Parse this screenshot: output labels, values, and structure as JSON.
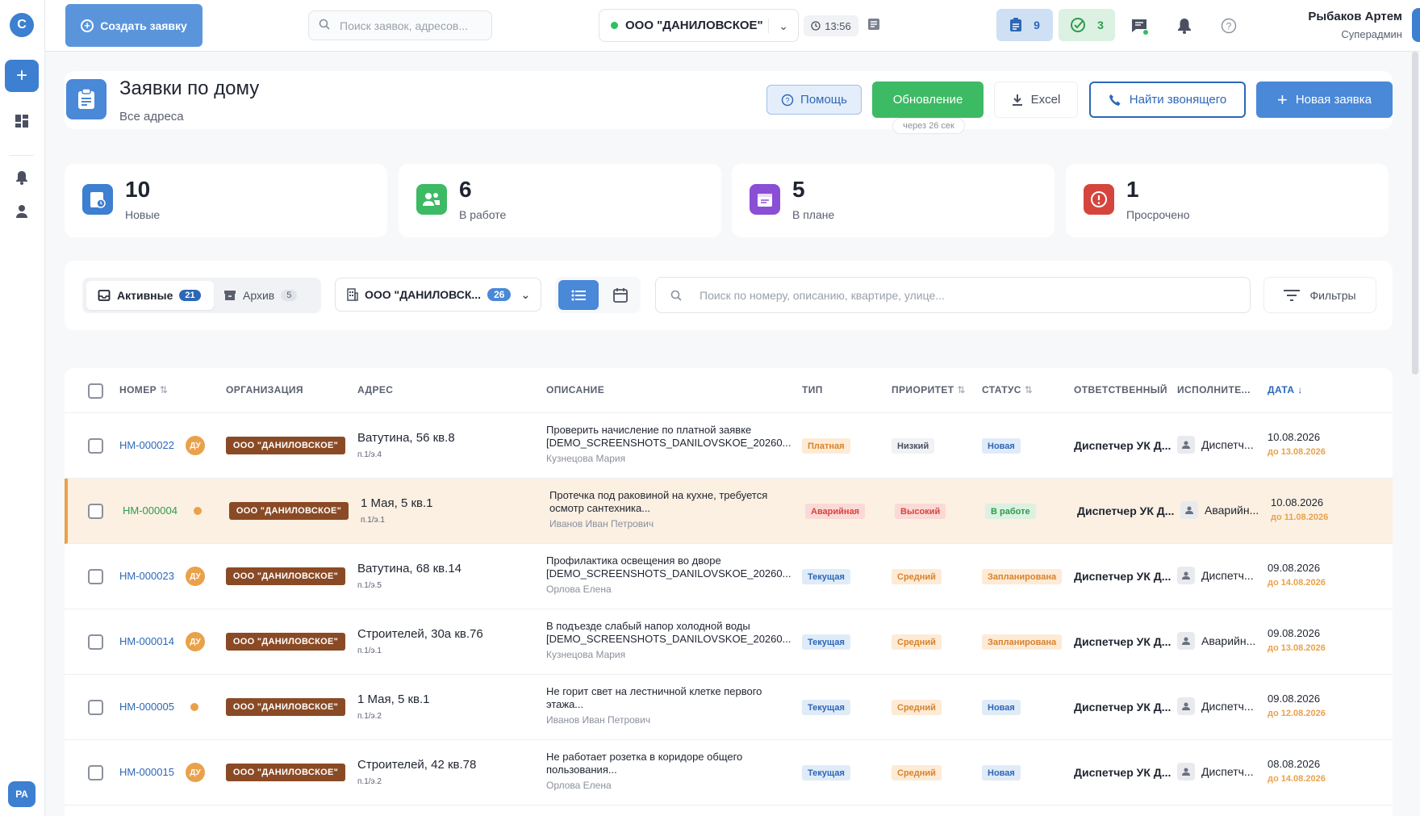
{
  "rail": {
    "logo": "С",
    "add_label": "+",
    "bottom_avatar": "РА"
  },
  "topbar": {
    "create_label": "Создать заявку",
    "search_placeholder": "Поиск заявок, адресов...",
    "org_name": "ООО \"ДАНИЛОВСКОЕ\"",
    "time": "13:56",
    "tasks_count": "9",
    "done_count": "3",
    "user_name": "Рыбаков Артем",
    "user_role": "Суперадмин"
  },
  "header": {
    "title": "Заявки по дому",
    "subtitle": "Все адреса",
    "help_label": "Помощь",
    "refresh_label": "Обновление",
    "refresh_hint": "через 26 сек",
    "excel_label": "Excel",
    "find_caller_label": "Найти звонящего",
    "new_label": "Новая заявка"
  },
  "stats": [
    {
      "value": "10",
      "label": "Новые",
      "color": "#3d7fd0"
    },
    {
      "value": "6",
      "label": "В работе",
      "color": "#3dba64"
    },
    {
      "value": "5",
      "label": "В плане",
      "color": "#8b4fd6"
    },
    {
      "value": "1",
      "label": "Просрочено",
      "color": "#d6453d"
    }
  ],
  "filters": {
    "active_label": "Активные",
    "active_count": "21",
    "archive_label": "Архив",
    "archive_count": "5",
    "org_label": "ООО \"ДАНИЛОВСК...",
    "org_count": "26",
    "search_placeholder": "Поиск по номеру, описанию, квартире, улице...",
    "filters_label": "Фильтры"
  },
  "table": {
    "headers": {
      "number": "НОМЕР",
      "org": "ОРГАНИЗАЦИЯ",
      "address": "АДРЕС",
      "description": "ОПИСАНИЕ",
      "type": "ТИП",
      "priority": "ПРИОРИТЕТ",
      "status": "СТАТУС",
      "responsible": "ОТВЕТСТВЕННЫЙ",
      "executor": "ИСПОЛНИТЕ...",
      "date": "ДАТА ↓"
    },
    "rows": [
      {
        "number": "НМ-000022",
        "du": "ДУ",
        "org": "ООО \"ДАНИЛОВСКОЕ\"",
        "address": "Ватутина, 56 кв.8",
        "sub": "п.1/э.4",
        "desc": "Проверить начисление по платной заявке [DEMO_SCREENSHOTS_DANILOVSKOE_20260...",
        "author": "Кузнецова Мария",
        "type": "Платная",
        "priority": "Низкий",
        "status": "Новая",
        "responsible": "Диспетчер УК Д...",
        "executor": "Диспетч...",
        "date": "10.08.2026",
        "due": "до 13.08.2026"
      },
      {
        "number": "НМ-000004",
        "du": "",
        "org": "ООО \"ДАНИЛОВСКОЕ\"",
        "address": "1 Мая, 5 кв.1",
        "sub": "п.1/э.1",
        "desc": "Протечка под раковиной на кухне, требуется осмотр сантехника...",
        "author": "Иванов Иван Петрович",
        "type": "Аварийная",
        "priority": "Высокий",
        "status": "В работе",
        "responsible": "Диспетчер УК Д...",
        "executor": "Аварийн...",
        "date": "10.08.2026",
        "due": "до 11.08.2026"
      },
      {
        "number": "НМ-000023",
        "du": "ДУ",
        "org": "ООО \"ДАНИЛОВСКОЕ\"",
        "address": "Ватутина, 68 кв.14",
        "sub": "п.1/э.5",
        "desc": "Профилактика освещения во дворе [DEMO_SCREENSHOTS_DANILOVSKOE_20260...",
        "author": "Орлова Елена",
        "type": "Текущая",
        "priority": "Средний",
        "status": "Запланирована",
        "responsible": "Диспетчер УК Д...",
        "executor": "Диспетч...",
        "date": "09.08.2026",
        "due": "до 14.08.2026"
      },
      {
        "number": "НМ-000014",
        "du": "ДУ",
        "org": "ООО \"ДАНИЛОВСКОЕ\"",
        "address": "Строителей, 30а кв.76",
        "sub": "п.1/э.1",
        "desc": "В подъезде слабый напор холодной воды [DEMO_SCREENSHOTS_DANILOVSKOE_20260...",
        "author": "Кузнецова Мария",
        "type": "Текущая",
        "priority": "Средний",
        "status": "Запланирована",
        "responsible": "Диспетчер УК Д...",
        "executor": "Аварийн...",
        "date": "09.08.2026",
        "due": "до 13.08.2026"
      },
      {
        "number": "НМ-000005",
        "du": "",
        "org": "ООО \"ДАНИЛОВСКОЕ\"",
        "address": "1 Мая, 5 кв.1",
        "sub": "п.1/э.2",
        "desc": "Не горит свет на лестничной клетке первого этажа...",
        "author": "Иванов Иван Петрович",
        "type": "Текущая",
        "priority": "Средний",
        "status": "Новая",
        "responsible": "Диспетчер УК Д...",
        "executor": "Диспетч...",
        "date": "09.08.2026",
        "due": "до 12.08.2026"
      },
      {
        "number": "НМ-000015",
        "du": "ДУ",
        "org": "ООО \"ДАНИЛОВСКОЕ\"",
        "address": "Строителей, 42 кв.78",
        "sub": "п.1/э.2",
        "desc": "Не работает розетка в коридоре общего пользования...",
        "author": "Орлова Елена",
        "type": "Текущая",
        "priority": "Средний",
        "status": "Новая",
        "responsible": "Диспетчер УК Д...",
        "executor": "Диспетч...",
        "date": "08.08.2026",
        "due": "до 14.08.2026"
      }
    ]
  }
}
